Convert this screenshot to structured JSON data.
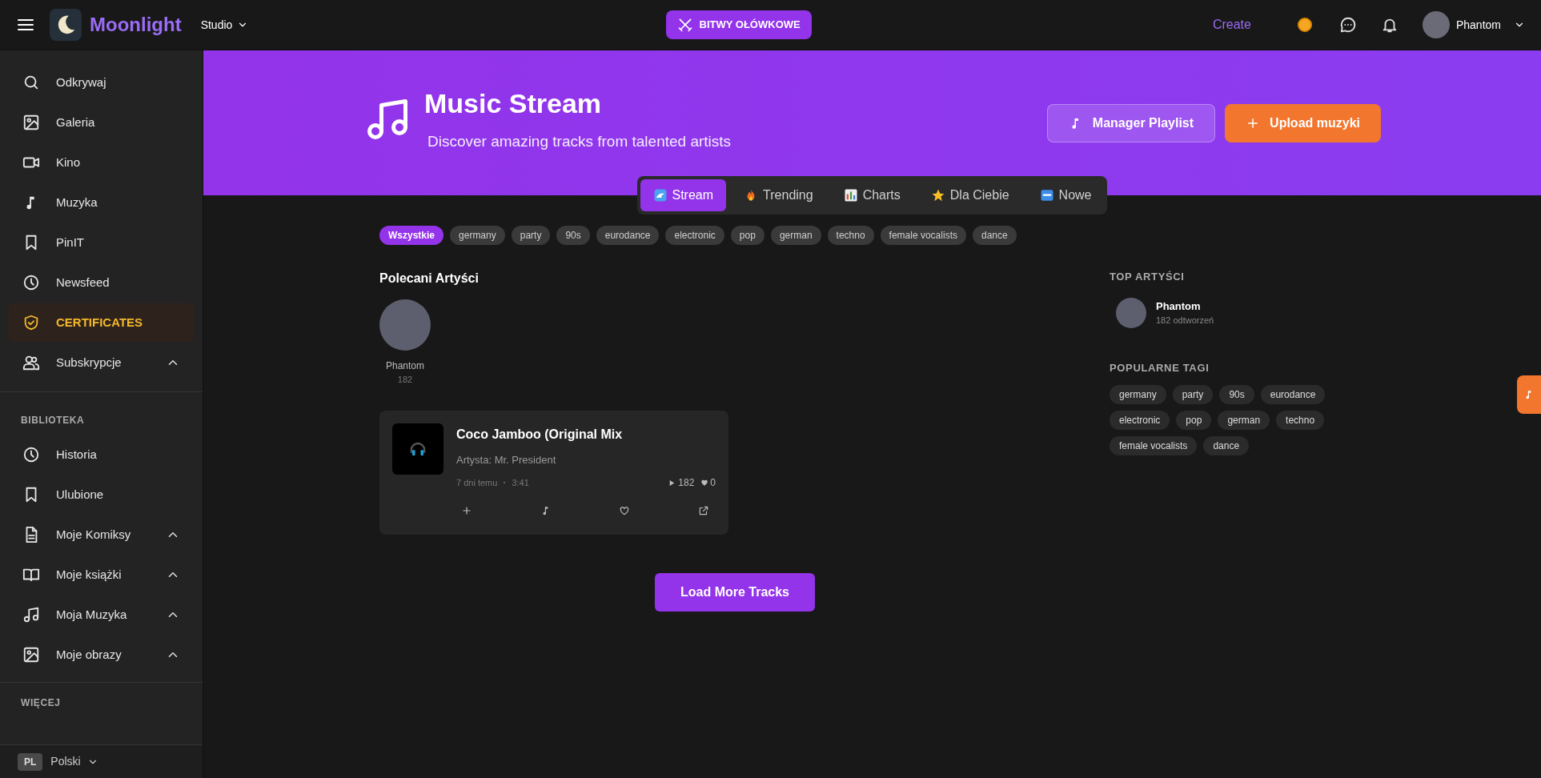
{
  "topbar": {
    "logo": "Moonlight",
    "studio": "Studio",
    "battle_button": "BITWY OŁÓWKOWE",
    "create": "Create",
    "user": "Phantom"
  },
  "sidebar": {
    "items": [
      {
        "label": "Odkrywaj",
        "selected": false,
        "collapsible": false
      },
      {
        "label": "Galeria",
        "selected": false,
        "collapsible": false
      },
      {
        "label": "Kino",
        "selected": false,
        "collapsible": false
      },
      {
        "label": "Muzyka",
        "selected": false,
        "collapsible": false
      },
      {
        "label": "PinIT",
        "selected": false,
        "collapsible": false
      },
      {
        "label": "Newsfeed",
        "selected": false,
        "collapsible": false
      },
      {
        "label": "CERTIFICATES",
        "selected": true,
        "collapsible": false
      },
      {
        "label": "Subskrypcje",
        "selected": false,
        "collapsible": true
      }
    ],
    "library_title": "BIBLIOTEKA",
    "library": [
      {
        "label": "Historia",
        "collapsible": false
      },
      {
        "label": "Ulubione",
        "collapsible": false
      },
      {
        "label": "Moje Komiksy",
        "collapsible": true
      },
      {
        "label": "Moje książki",
        "collapsible": true
      },
      {
        "label": "Moja Muzyka",
        "collapsible": true
      },
      {
        "label": "Moje obrazy",
        "collapsible": true
      }
    ],
    "more_title": "WIĘCEJ",
    "language": {
      "code": "PL",
      "label": "Polski"
    }
  },
  "hero": {
    "title": "Music Stream",
    "subtitle": "Discover amazing tracks from talented artists",
    "buttons": [
      {
        "label": "Manager Playlist",
        "kind": "secondary"
      },
      {
        "label": "Upload muzyki",
        "kind": "primary"
      }
    ]
  },
  "tabs": [
    {
      "label": "Stream",
      "selected": true
    },
    {
      "label": "Trending",
      "selected": false
    },
    {
      "label": "Charts",
      "selected": false
    },
    {
      "label": "Dla Ciebie",
      "selected": false
    },
    {
      "label": "Nowe",
      "selected": false
    }
  ],
  "filters": [
    {
      "label": "Wszystkie",
      "selected": true
    },
    {
      "label": "germany",
      "selected": false
    },
    {
      "label": "party",
      "selected": false
    },
    {
      "label": "90s",
      "selected": false
    },
    {
      "label": "eurodance",
      "selected": false
    },
    {
      "label": "electronic",
      "selected": false
    },
    {
      "label": "pop",
      "selected": false
    },
    {
      "label": "german",
      "selected": false
    },
    {
      "label": "techno",
      "selected": false
    },
    {
      "label": "female vocalists",
      "selected": false
    },
    {
      "label": "dance",
      "selected": false
    }
  ],
  "featured_artists": {
    "title": "Polecani Artyści",
    "artists": [
      {
        "name": "Phantom",
        "count": "182"
      }
    ]
  },
  "tracks": [
    {
      "title": "Coco Jamboo (Original Mix",
      "artist": "Artysta: Mr. President",
      "age": "7 dni temu",
      "duration": "3:41",
      "plays": "182",
      "likes": "0"
    }
  ],
  "load_more": "Load More Tracks",
  "top_artists": {
    "title": "TOP ARTYŚCI",
    "artists": [
      {
        "name": "Phantom",
        "plays": "182 odtworzeń"
      }
    ]
  },
  "popular_tags": {
    "title": "POPULARNE TAGI",
    "tags": [
      "germany",
      "party",
      "90s",
      "eurodance",
      "electronic",
      "pop",
      "german",
      "techno",
      "female vocalists",
      "dance"
    ]
  }
}
